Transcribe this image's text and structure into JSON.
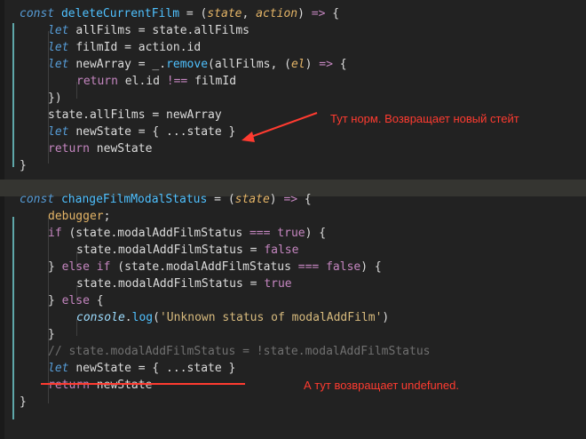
{
  "editor": {
    "lines": [
      {
        "segments": [
          [
            "let",
            "const "
          ],
          [
            "fn",
            "deleteCurrentFilm"
          ],
          [
            "plain",
            " = ("
          ],
          [
            "param",
            "state"
          ],
          [
            "plain",
            ", "
          ],
          [
            "param",
            "action"
          ],
          [
            "plain",
            ") "
          ],
          [
            "op",
            "=>"
          ],
          [
            "plain",
            " {"
          ]
        ]
      },
      {
        "segments": [
          [
            "let",
            "let "
          ],
          [
            "plain",
            "allFilms = state.allFilms"
          ]
        ]
      },
      {
        "segments": [
          [
            "let",
            "let "
          ],
          [
            "plain",
            "filmId = action.id"
          ]
        ]
      },
      {
        "segments": [
          [
            "let",
            "let "
          ],
          [
            "plain",
            "newArray = _."
          ],
          [
            "fn",
            "remove"
          ],
          [
            "plain",
            "(allFilms, ("
          ],
          [
            "param",
            "el"
          ],
          [
            "plain",
            ") "
          ],
          [
            "op",
            "=>"
          ],
          [
            "plain",
            " {"
          ]
        ]
      },
      {
        "segments": [
          [
            "ret",
            "return "
          ],
          [
            "plain",
            "el.id "
          ],
          [
            "op",
            "!=="
          ],
          [
            "plain",
            " filmId"
          ]
        ]
      },
      {
        "segments": [
          [
            "plain",
            "})"
          ]
        ]
      },
      {
        "segments": [
          [
            "plain",
            "state.allFilms = newArray"
          ]
        ]
      },
      {
        "segments": [
          [
            "let",
            "let "
          ],
          [
            "plain",
            "newState = { ...state }"
          ]
        ]
      },
      {
        "segments": [
          [
            "ret",
            "return "
          ],
          [
            "plain",
            "newState"
          ]
        ]
      },
      {
        "segments": [
          [
            "plain",
            "}"
          ]
        ]
      },
      {
        "segments": []
      },
      {
        "segments": [
          [
            "let",
            "const "
          ],
          [
            "fn",
            "changeFilmModalStatus"
          ],
          [
            "plain",
            " = ("
          ],
          [
            "param",
            "state"
          ],
          [
            "plain",
            ") "
          ],
          [
            "op",
            "=>"
          ],
          [
            "plain",
            " {"
          ]
        ]
      },
      {
        "segments": [
          [
            "dbg",
            "debugger"
          ],
          [
            "plain",
            ";"
          ]
        ]
      },
      {
        "segments": [
          [
            "ret",
            "if "
          ],
          [
            "plain",
            "(state.modalAddFilmStatus "
          ],
          [
            "op",
            "==="
          ],
          [
            "plain",
            " "
          ],
          [
            "bool",
            "true"
          ],
          [
            "plain",
            ") {"
          ]
        ]
      },
      {
        "segments": [
          [
            "plain",
            "state.modalAddFilmStatus = "
          ],
          [
            "bool",
            "false"
          ]
        ]
      },
      {
        "segments": [
          [
            "plain",
            "} "
          ],
          [
            "ret",
            "else if "
          ],
          [
            "plain",
            "(state.modalAddFilmStatus "
          ],
          [
            "op",
            "==="
          ],
          [
            "plain",
            " "
          ],
          [
            "bool",
            "false"
          ],
          [
            "plain",
            ") {"
          ]
        ]
      },
      {
        "segments": [
          [
            "plain",
            "state.modalAddFilmStatus = "
          ],
          [
            "bool",
            "true"
          ]
        ]
      },
      {
        "segments": [
          [
            "plain",
            "} "
          ],
          [
            "ret",
            "else "
          ],
          [
            "plain",
            "{"
          ]
        ]
      },
      {
        "segments": [
          [
            "console",
            "console"
          ],
          [
            "plain",
            "."
          ],
          [
            "fn",
            "log"
          ],
          [
            "plain",
            "("
          ],
          [
            "str",
            "'Unknown status of modalAddFilm'"
          ],
          [
            "plain",
            ")"
          ]
        ]
      },
      {
        "segments": [
          [
            "plain",
            "}"
          ]
        ]
      },
      {
        "segments": [
          [
            "cm",
            "// state.modalAddFilmStatus = !state.modalAddFilmStatus"
          ]
        ]
      },
      {
        "segments": [
          [
            "let",
            "let "
          ],
          [
            "plain",
            "newState = { ...state }"
          ]
        ]
      },
      {
        "segments": [
          [
            "ret",
            "return "
          ],
          [
            "plain",
            "newState"
          ]
        ]
      },
      {
        "segments": [
          [
            "plain",
            "}"
          ]
        ]
      }
    ]
  },
  "annotations": {
    "first": "Тут норм. Возвращает новый стейт",
    "second": "А тут возвращает undefuned."
  },
  "colors": {
    "background": "#222222",
    "annotation": "#ff3b30",
    "scope_bar": "#5fa7a9"
  }
}
